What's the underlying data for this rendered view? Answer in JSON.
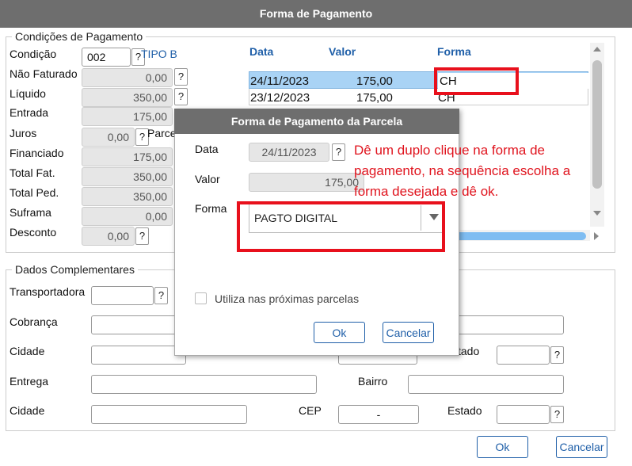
{
  "window_title": "Forma de Pagamento",
  "cond_group": {
    "title": "Condições de Pagamento",
    "condicao_label": "Condição",
    "condicao_value": "002",
    "condicao_desc": "TIPO B",
    "nao_faturado_label": "Não Faturado",
    "nao_faturado_value": "0,00",
    "liquido_label": "Líquido",
    "liquido_value": "350,00",
    "entrada_label": "Entrada",
    "entrada_value": "175,00",
    "juros_label": "Juros",
    "juros_value": "0,00",
    "parcelas_label": "Parce",
    "financiado_label": "Financiado",
    "financiado_value": "175,00",
    "total_fat_label": "Total Fat.",
    "total_fat_value": "350,00",
    "total_ped_label": "Total Ped.",
    "total_ped_value": "350,00",
    "suframa_label": "Suframa",
    "suframa_value": "0,00",
    "desconto_label": "Desconto",
    "desconto_value": "0,00",
    "help": "?"
  },
  "grid": {
    "headers": [
      "Data",
      "Valor",
      "Forma"
    ],
    "rows": [
      {
        "data": "24/11/2023",
        "valor": "175,00",
        "forma": "CH"
      },
      {
        "data": "23/12/2023",
        "valor": "175,00",
        "forma": "CH"
      }
    ]
  },
  "dados": {
    "title": "Dados Complementares",
    "transportadora_label": "Transportadora",
    "cobranca_label": "Cobrança",
    "cidade_label": "Cidade",
    "estado_label": "Estado",
    "estado_partial_label": "tado",
    "entrega_label": "Entrega",
    "bairro_label": "Bairro",
    "cidade2_label": "Cidade",
    "cep_label": "CEP",
    "cep_value": "-",
    "estado2_label": "Estado"
  },
  "dialog": {
    "title": "Forma de Pagamento da Parcela",
    "data_label": "Data",
    "data_value": "24/11/2023",
    "valor_label": "Valor",
    "valor_value": "175,00",
    "forma_label": "Forma",
    "forma_value": "PAGTO DIGITAL",
    "checkbox_label": "Utiliza nas próximas parcelas",
    "ok": "Ok",
    "cancel": "Cancelar"
  },
  "annotation": "Dê um duplo clique na forma de pagamento, na sequência escolha a forma desejada e dê ok.",
  "footer": {
    "ok": "Ok",
    "cancel": "Cancelar"
  },
  "colors": {
    "titlebar": "#6e6e6e",
    "accent": "#1f5fa8",
    "highlight": "#e8101c",
    "selected_row": "#a9d3f5"
  }
}
